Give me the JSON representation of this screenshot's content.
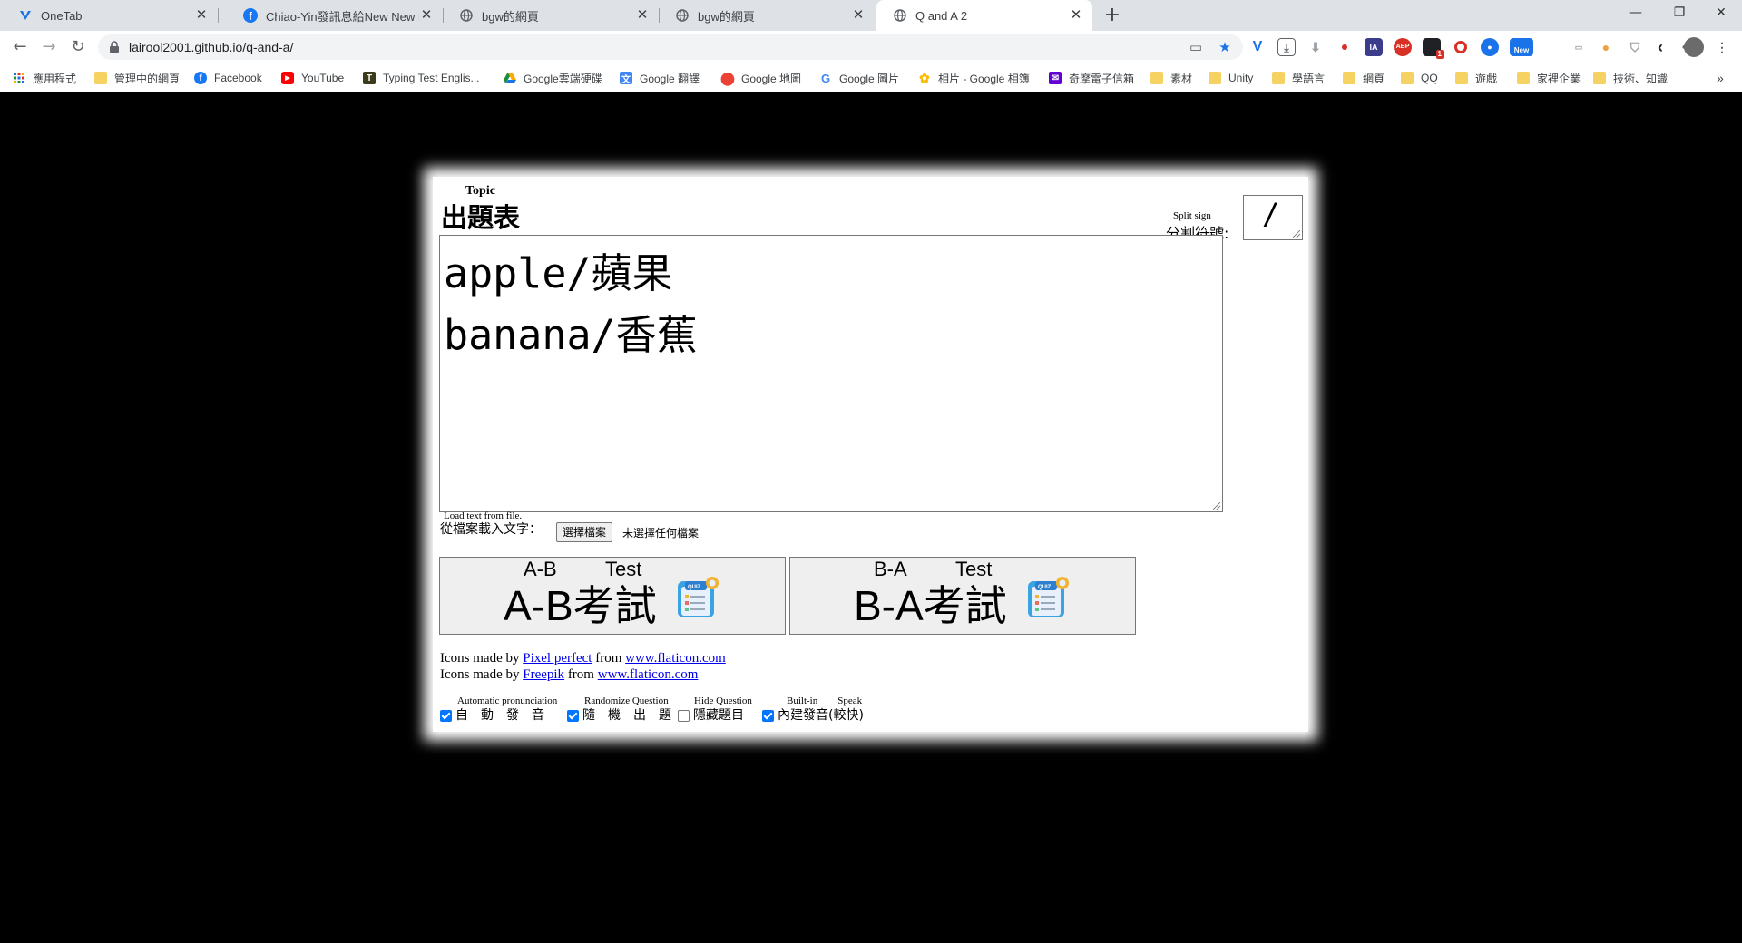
{
  "browser": {
    "tabs": [
      {
        "title": "OneTab",
        "icon": "onetab-icon"
      },
      {
        "title": "Chiao-Yin發訊息給New New En",
        "icon": "facebook-icon"
      },
      {
        "title": "bgw的網頁",
        "icon": "globe-icon"
      },
      {
        "title": "bgw的網頁",
        "icon": "globe-icon"
      },
      {
        "title": "Q and A 2",
        "icon": "globe-icon"
      }
    ],
    "new_tab": "+",
    "url": "lairool2001.github.io/q-and-a/",
    "bookmarks": [
      {
        "label": "應用程式",
        "icon": "apps-grid-icon"
      },
      {
        "label": "管理中的網頁",
        "icon": "folder-icon"
      },
      {
        "label": "Facebook",
        "icon": "facebook-icon"
      },
      {
        "label": "YouTube",
        "icon": "youtube-icon"
      },
      {
        "label": "Typing Test Englis...",
        "icon": "typing-icon"
      },
      {
        "label": "Google雲端硬碟",
        "icon": "google-drive-icon"
      },
      {
        "label": "Google 翻譯",
        "icon": "google-translate-icon"
      },
      {
        "label": "Google 地圖",
        "icon": "google-maps-icon"
      },
      {
        "label": "Google 圖片",
        "icon": "google-icon"
      },
      {
        "label": "相片 - Google 相簿",
        "icon": "google-photos-icon"
      },
      {
        "label": "奇摩電子信箱",
        "icon": "yahoo-mail-icon"
      },
      {
        "label": "素材",
        "icon": "folder-icon"
      },
      {
        "label": "Unity",
        "icon": "folder-icon"
      },
      {
        "label": "學語言",
        "icon": "folder-icon"
      },
      {
        "label": "網頁",
        "icon": "folder-icon"
      },
      {
        "label": "QQ",
        "icon": "folder-icon"
      },
      {
        "label": "遊戲",
        "icon": "folder-icon"
      },
      {
        "label": "家裡企業",
        "icon": "folder-icon"
      },
      {
        "label": "技術、知識",
        "icon": "folder-icon"
      }
    ],
    "extensions": {
      "ia_label": "IA",
      "abp_label": "ABP",
      "badge_count": "1",
      "new_label": "New"
    }
  },
  "page": {
    "topic_sub": "Topic",
    "title": "出題表",
    "split_sub": "Split      sign",
    "split_label": "分割符號:",
    "split_value": "/",
    "textarea_lines": [
      "apple/蘋果",
      "banana/香蕉"
    ],
    "file_sub": "Load     text     from     file.",
    "file_label": "從檔案載入文字：",
    "file_button": "選擇檔案",
    "file_status": "未選擇任何檔案",
    "ab_button": {
      "sub_left": "A-B",
      "sub_right": "Test",
      "label": "A-B考試"
    },
    "ba_button": {
      "sub_left": "B-A",
      "sub_right": "Test",
      "label": "B-A考試"
    },
    "credits": [
      {
        "prefix": "Icons made by ",
        "author": "Pixel perfect",
        "mid": " from ",
        "site": "www.flaticon.com"
      },
      {
        "prefix": "Icons made by ",
        "author": "Freepik",
        "mid": " from ",
        "site": "www.flaticon.com"
      }
    ],
    "options_sub": {
      "auto": "Automatic pronunciation",
      "random": "Randomize Question",
      "hide": "Hide Question",
      "builtin": "Built-in        Speak"
    },
    "options": [
      {
        "label": "自　動　發　音",
        "checked": true
      },
      {
        "label": "隨　機　出　題",
        "checked": true
      },
      {
        "label": "隱藏題目",
        "checked": false
      },
      {
        "label": "內建發音(較快)",
        "checked": true
      }
    ]
  },
  "colors": {
    "page_background": "#000000",
    "checkbox_accent": "#0075ff",
    "link": "#0000ee"
  }
}
